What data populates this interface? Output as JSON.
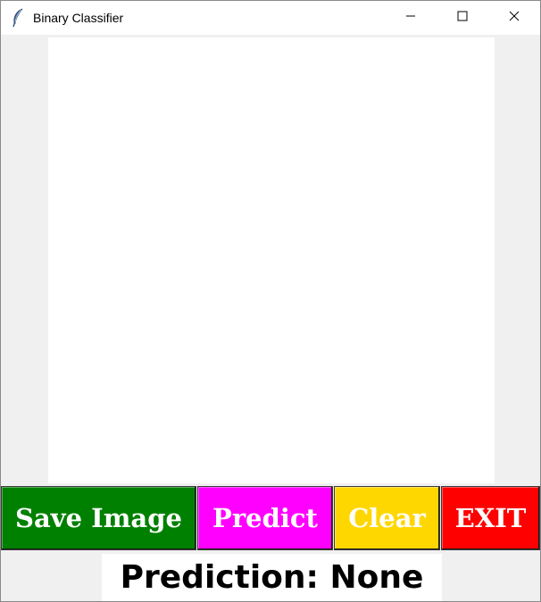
{
  "window": {
    "title": "Binary Classifier",
    "app_icon": "feather-icon",
    "controls": {
      "minimize_icon": "minimize-icon",
      "maximize_icon": "maximize-icon",
      "close_icon": "close-icon"
    }
  },
  "canvas": {
    "background": "#ffffff"
  },
  "buttons": {
    "save": {
      "label": "Save Image",
      "color": "#008000"
    },
    "predict": {
      "label": "Predict",
      "color": "#ff00ff"
    },
    "clear": {
      "label": "Clear",
      "color": "#ffd700"
    },
    "exit": {
      "label": "EXIT",
      "color": "#ff0000"
    }
  },
  "prediction": {
    "label": "Prediction: None"
  }
}
